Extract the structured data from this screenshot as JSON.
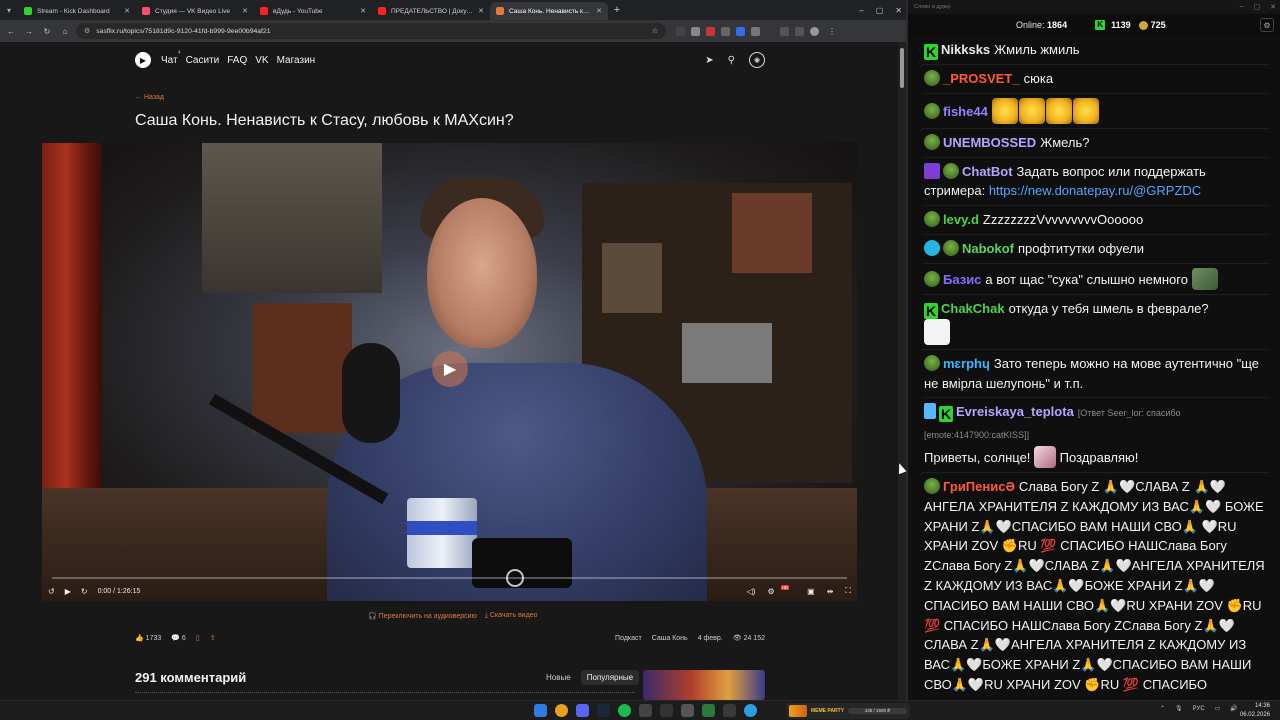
{
  "browser": {
    "tabs": [
      {
        "title": "Stream - Kick Dashboard",
        "favicon_color": "#2ed52e",
        "active": false
      },
      {
        "title": "Студия — VK Видео Live",
        "favicon_color": "#ff4d6a",
        "active": false
      },
      {
        "title": "вДудь - YouTube",
        "favicon_color": "#ff2020",
        "active": false
      },
      {
        "title": "ПРЕДАТЕЛЬСТВО | Документальный...",
        "favicon_color": "#ff2020",
        "active": false
      },
      {
        "title": "Саша Конь. Ненависть к Стасу...",
        "favicon_color": "#e07a3a",
        "active": true
      }
    ],
    "url": "sasflix.ru/topics/75181d9c-9120-41fd-b999-9ee00b94af21",
    "window_controls": [
      "–",
      "▢",
      "✕"
    ]
  },
  "site": {
    "nav": [
      {
        "label": "Чат",
        "sup": "4"
      },
      {
        "label": "Сасити",
        "sup": ""
      },
      {
        "label": "FAQ",
        "sup": ""
      },
      {
        "label": "VK",
        "sup": ""
      },
      {
        "label": "Магазин",
        "sup": ""
      }
    ],
    "back_label": "← Назад",
    "title": "Саша Конь. Ненависть к Стасу, любовь к МАХсин?",
    "player": {
      "time": "0:00 / 1:26:15",
      "progress_fraction": 0.0,
      "hd_badge": "HD"
    },
    "below_links": [
      "Переключить на аудиоверсию",
      "Скачать видео"
    ],
    "meta": {
      "likes": "1733",
      "comments_count": "6",
      "category": "Подкаст",
      "author": "Саша Конь",
      "date": "4 февр.",
      "views": "24 152"
    },
    "comments_title": "291 комментарий",
    "sort_options": [
      {
        "label": "Новые",
        "active": false
      },
      {
        "label": "Популярные",
        "active": true
      }
    ]
  },
  "chat": {
    "titlebar": "Слово и дурку",
    "online_label": "Online:",
    "online_value": "1864",
    "kick_count": "1139",
    "coin_count": "725",
    "messages": [
      {
        "badges": [
          "kick"
        ],
        "user": "Nikksks",
        "color": "#e8e8e8",
        "text": "Жмиль жмиль"
      },
      {
        "badges": [
          "pepe"
        ],
        "user": "_PROSVET_",
        "color": "#ff5a3c",
        "text": "сюка"
      },
      {
        "badges": [
          "pepe"
        ],
        "user": "fishe44",
        "color": "#9b7dff",
        "text": "",
        "emotes": 4
      },
      {
        "badges": [
          "pepe"
        ],
        "user": "UNEMBOSSED",
        "color": "#b8a4ff",
        "text": "Жмель?"
      },
      {
        "badges": [
          "bot",
          "pepe"
        ],
        "user": "ChatBot",
        "color": "#b8a4ff",
        "text": "Задать вопрос или поддержать стримера:",
        "link": "https://new.donatepay.ru/@GRPZDC"
      },
      {
        "badges": [
          "pepe"
        ],
        "user": "levy.d",
        "color": "#4fd14f",
        "text": "ZzzzzzzzVvvvvvvvvOooooo"
      },
      {
        "badges": [
          "verify",
          "pepe"
        ],
        "user": "Nabokof",
        "color": "#5cd35c",
        "text": "профтитутки офуели"
      },
      {
        "badges": [
          "pepe"
        ],
        "user": "Базис",
        "color": "#8a6bff",
        "text": "а вот щас \"сука\" слышно немного",
        "trail_emote": "sm"
      },
      {
        "badges": [
          "kick"
        ],
        "user": "ChakChak",
        "color": "#4fd14f",
        "text": "откуда у тебя шмель в феврале?",
        "trail_emote": "wh"
      },
      {
        "badges": [
          "pepe"
        ],
        "user": "mɛrphɥ",
        "color": "#38b6ff",
        "text": "Зато теперь можно на мове аутентично \"ще не вмірла шелупонь\" и т.п."
      },
      {
        "badges": [
          "sword",
          "kick"
        ],
        "user": "Evreiskaya_teplota",
        "color": "#b8a4ff",
        "reply": "[Ответ Seer_lor: спасибо [emote:4147900:catKISS]]",
        "text": "Приветы, солнце!",
        "mid_emote": "cat",
        "text2": "Поздравляю!"
      },
      {
        "badges": [
          "pepe"
        ],
        "user": "ГриПенисӘ",
        "color": "#ff5a3c",
        "text": "Слава Богу Z 🙏🤍СЛАВА Z 🙏🤍 АНГЕЛА ХРАНИТЕЛЯ Z КАЖДОМУ ИЗ ВАС🙏🤍 БОЖЕ ХРАНИ Z🙏🤍СПАСИБО ВАМ НАШИ СВО🙏 🤍RU ХРАНИ ZOV ✊RU 💯 СПАСИБО НАШСлава Богу ZСлава Богу Z🙏🤍СЛАВА Z🙏🤍АНГЕЛА ХРАНИТЕЛЯ Z КАЖДОМУ ИЗ ВАС🙏🤍БОЖЕ ХРАНИ Z🙏🤍СПАСИБО ВАМ НАШИ СВО🙏🤍RU ХРАНИ ZOV ✊RU 💯 СПАСИБО НАШСлава Богу ZСлава Богу Z🙏🤍СЛАВА Z🙏🤍АНГЕЛА ХРАНИТЕЛЯ Z КАЖДОМУ ИЗ ВАС🙏🤍БОЖЕ ХРАНИ Z🙏🤍СПАСИБО ВАМ НАШИ СВО🙏🤍RU ХРАНИ ZOV ✊RU 💯 СПАСИБО НАШСлава Богу Z"
      }
    ]
  },
  "taskbar": {
    "widget_title": "MEME PARTY",
    "widget_progress": "435 / 1500 ₽",
    "lang": "РУС",
    "time": "14:36",
    "date": "06.02.2026"
  }
}
